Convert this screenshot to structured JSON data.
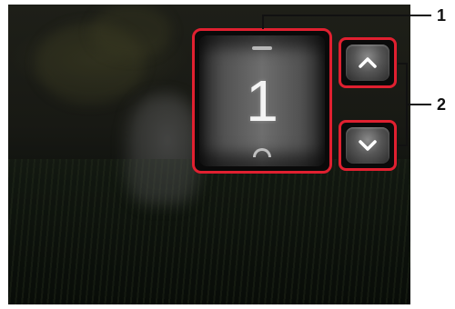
{
  "display": {
    "number_value": "1"
  },
  "buttons": {
    "up_icon": "chevron-up-icon",
    "down_icon": "chevron-down-icon"
  },
  "callouts": {
    "label_1": "1",
    "label_2": "2"
  },
  "colors": {
    "highlight": "#e02030",
    "arrow": "#ffffff"
  }
}
